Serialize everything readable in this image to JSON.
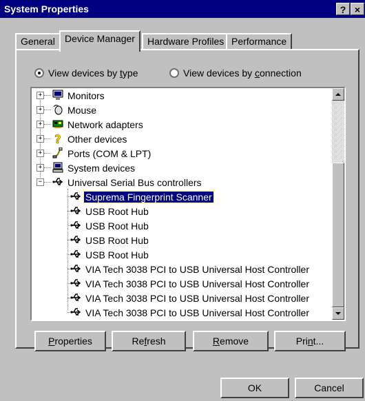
{
  "window": {
    "title": "System Properties",
    "help_btn": "?",
    "close_btn": "×"
  },
  "tabs": [
    {
      "label": "General"
    },
    {
      "label": "Device Manager"
    },
    {
      "label": "Hardware Profiles"
    },
    {
      "label": "Performance"
    }
  ],
  "view": {
    "by_type": {
      "pre": "View devices by ",
      "key": "t",
      "post": "ype"
    },
    "by_connection": {
      "pre": "View devices by ",
      "key": "c",
      "post": "onnection"
    }
  },
  "tree": {
    "categories": [
      {
        "label": "Monitors",
        "icon": "monitor-icon",
        "expander": "+"
      },
      {
        "label": "Mouse",
        "icon": "mouse-icon",
        "expander": "+"
      },
      {
        "label": "Network adapters",
        "icon": "network-adapter-icon",
        "expander": "+"
      },
      {
        "label": "Other devices",
        "icon": "question-icon",
        "expander": "+"
      },
      {
        "label": "Ports (COM & LPT)",
        "icon": "port-icon",
        "expander": "+"
      },
      {
        "label": "System devices",
        "icon": "computer-icon",
        "expander": "+"
      },
      {
        "label": "Universal Serial Bus controllers",
        "icon": "usb-icon",
        "expander": "−"
      }
    ],
    "usb_children": [
      {
        "label": "Suprema Fingerprint Scanner"
      },
      {
        "label": "USB Root Hub"
      },
      {
        "label": "USB Root Hub"
      },
      {
        "label": "USB Root Hub"
      },
      {
        "label": "USB Root Hub"
      },
      {
        "label": "VIA Tech 3038 PCI to USB Universal Host Controller"
      },
      {
        "label": "VIA Tech 3038 PCI to USB Universal Host Controller"
      },
      {
        "label": "VIA Tech 3038 PCI to USB Universal Host Controller"
      },
      {
        "label": "VIA Tech 3038 PCI to USB Universal Host Controller"
      }
    ]
  },
  "buttons": {
    "properties": {
      "key": "P",
      "rest": "roperties"
    },
    "refresh": {
      "pre": "Re",
      "key": "f",
      "rest": "resh"
    },
    "remove": {
      "key": "R",
      "rest": "emove"
    },
    "print": {
      "pre": "Pri",
      "key": "n",
      "rest": "t..."
    },
    "ok": "OK",
    "cancel": "Cancel"
  }
}
